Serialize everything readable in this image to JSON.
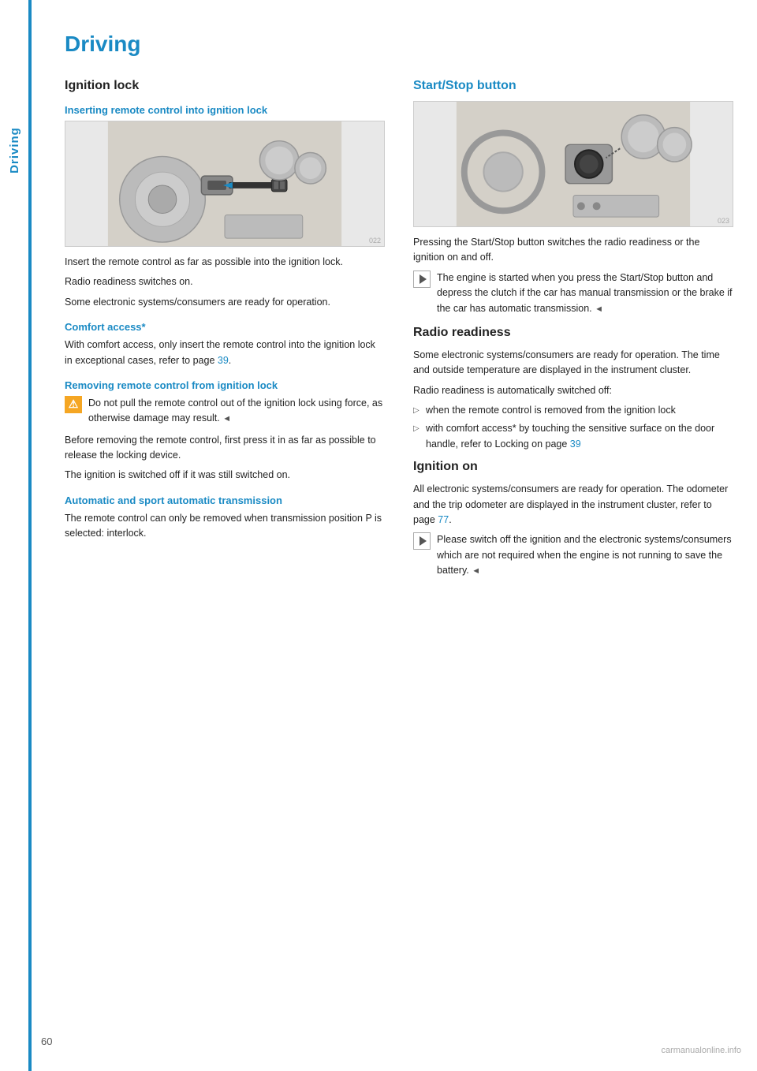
{
  "page": {
    "title": "Driving",
    "page_number": "60",
    "side_tab": "Driving",
    "bottom_logo": "carmanualonline.info"
  },
  "left_col": {
    "section_heading": "Ignition lock",
    "insert_sub_heading": "Inserting remote control into ignition lock",
    "insert_image_alt": "Ignition lock diagram - inserting remote control",
    "insert_body_1": "Insert the remote control as far as possible into the ignition lock.",
    "insert_body_2": "Radio readiness switches on.",
    "insert_body_3": "Some electronic systems/consumers are ready for operation.",
    "comfort_heading": "Comfort access*",
    "comfort_body": "With comfort access, only insert the remote control into the ignition lock in exceptional cases, refer to page",
    "comfort_page_link": "39",
    "comfort_body_end": ".",
    "removing_sub_heading": "Removing remote control from ignition lock",
    "warning_text": "Do not pull the remote control out of the ignition lock using force, as otherwise damage may result.",
    "warning_end_mark": "◄",
    "removing_body_1": "Before removing the remote control, first press it in as far as possible to release the locking device.",
    "removing_body_2": "The ignition is switched off if it was still switched on.",
    "auto_heading": "Automatic and sport automatic transmission",
    "auto_body": "The remote control can only be removed when transmission position P is selected: interlock."
  },
  "right_col": {
    "section_heading": "Start/Stop button",
    "start_image_alt": "Start/Stop button diagram",
    "start_body_1": "Pressing the Start/Stop button switches the radio readiness or the ignition on and off.",
    "note_text_1": "The engine is started when you press the Start/Stop button and depress the clutch if the car has manual transmission or the brake if the car has automatic transmission.",
    "note_end_mark_1": "◄",
    "radio_heading": "Radio readiness",
    "radio_body_1": "Some electronic systems/consumers are ready for operation. The time and outside temperature are displayed in the instrument cluster.",
    "radio_body_2": "Radio readiness is automatically switched off:",
    "radio_bullet_1": "when the remote control is removed from the ignition lock",
    "radio_bullet_2": "with comfort access* by touching the sensitive surface on the door handle, refer to Locking on page",
    "radio_bullet_page": "39",
    "ignition_heading": "Ignition on",
    "ignition_body_1": "All electronic systems/consumers are ready for operation. The odometer and the trip odometer are displayed in the instrument cluster, refer to page",
    "ignition_page_link": "77",
    "ignition_body_end": ".",
    "note_text_2": "Please switch off the ignition and the electronic systems/consumers which are not required when the engine is not running to save the battery.",
    "note_end_mark_2": "◄"
  }
}
